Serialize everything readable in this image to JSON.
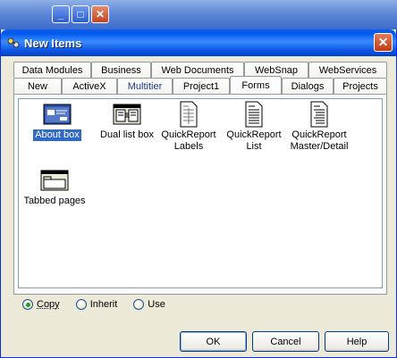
{
  "dialog": {
    "title": "New Items",
    "close_glyph": "✕"
  },
  "background_window": {
    "minimize_glyph": "_",
    "maximize_glyph": "□",
    "close_glyph": "✕"
  },
  "tabs": {
    "row1": [
      "Data Modules",
      "Business",
      "Web Documents",
      "WebSnap",
      "WebServices"
    ],
    "row2": [
      "New",
      "ActiveX",
      "Multitier",
      "Project1",
      "Forms",
      "Dialogs",
      "Projects"
    ],
    "active": "Forms"
  },
  "items": [
    {
      "label": "About box",
      "icon": "about-box-icon",
      "selected": true
    },
    {
      "label": "Dual list box",
      "icon": "dual-list-box-icon",
      "selected": false
    },
    {
      "label": "QuickReport Labels",
      "icon": "report-labels-icon",
      "selected": false
    },
    {
      "label": "QuickReport List",
      "icon": "report-list-icon",
      "selected": false
    },
    {
      "label": "QuickReport Master/Detail",
      "icon": "report-master-detail-icon",
      "selected": false
    },
    {
      "label": "Tabbed pages",
      "icon": "tabbed-pages-icon",
      "selected": false
    }
  ],
  "options": [
    {
      "label": "Copy",
      "checked": true
    },
    {
      "label": "Inherit",
      "checked": false
    },
    {
      "label": "Use",
      "checked": false
    }
  ],
  "buttons": {
    "ok": "OK",
    "cancel": "Cancel",
    "help": "Help"
  },
  "colors": {
    "selection": "#316ac5",
    "titlebar": "#0058ee"
  }
}
